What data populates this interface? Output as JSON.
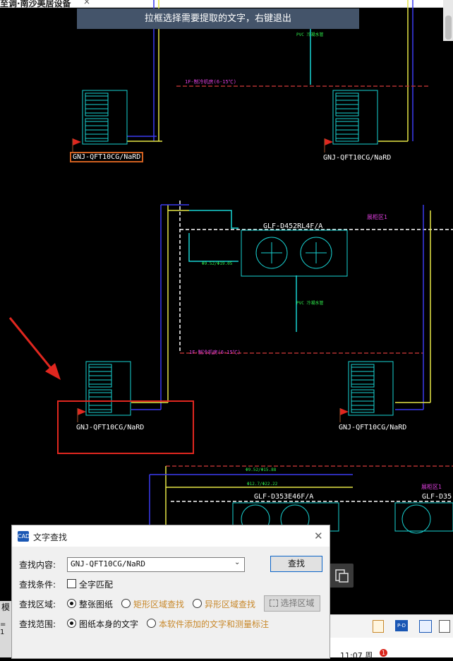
{
  "window": {
    "title": "至调·南沙美居设备",
    "close_glyph": "×"
  },
  "hint_banner": "拉框选择需要提取的文字，右键退出",
  "cad": {
    "unit_labels": [
      "GNJ-QFT10CG/NaRD",
      "GNJ-QFT10CG/NaRD",
      "GNJ-QFT10CG/NaRD",
      "GNJ-QFT10CG/NaRD"
    ],
    "cooler_labels": [
      "GLF-D452RL4F/A",
      "GLF-D353E46F/A",
      "GLF-D35"
    ],
    "magenta_labels": [
      "1F-制冷机房(6-15℃)",
      "1F-制冷机房(6-15℃)",
      "展柜区1",
      "展柜区1"
    ],
    "pipe_labels": [
      "PVC 冷凝水管",
      "PVC 冷凝水管",
      "Φ9.52/Φ15.88",
      "Φ12.7/Φ22.22",
      "Φ9.52/Φ19.05"
    ]
  },
  "dialog": {
    "icon_text": "CAD",
    "title": "文字查找",
    "close_glyph": "✕",
    "find_content_label": "查找内容:",
    "find_value": "GNJ-QFT10CG/NaRD",
    "find_button": "查找",
    "condition_label": "查找条件:",
    "whole_word": "全字匹配",
    "area_label": "查找区域:",
    "area_options": [
      "整张图纸",
      "矩形区域查找",
      "异形区域查找"
    ],
    "select_area_button": "选择区域",
    "scope_label": "查找范围:",
    "scope_options": [
      "图纸本身的文字",
      "本软件添加的文字和测量标注"
    ]
  },
  "statusbar": {
    "model_tab": "模",
    "coord": "= 1"
  },
  "taskbar": {
    "time": "11:07 周",
    "badge": "1"
  },
  "colors": {
    "cad_bg": "#000000",
    "cyan": "#19d3d3",
    "yellow": "#e6e645",
    "blue": "#3a3af0",
    "magenta": "#e040e0",
    "green": "#2ee84a",
    "highlight": "#e0271f",
    "orange_text": "#c8882a"
  }
}
